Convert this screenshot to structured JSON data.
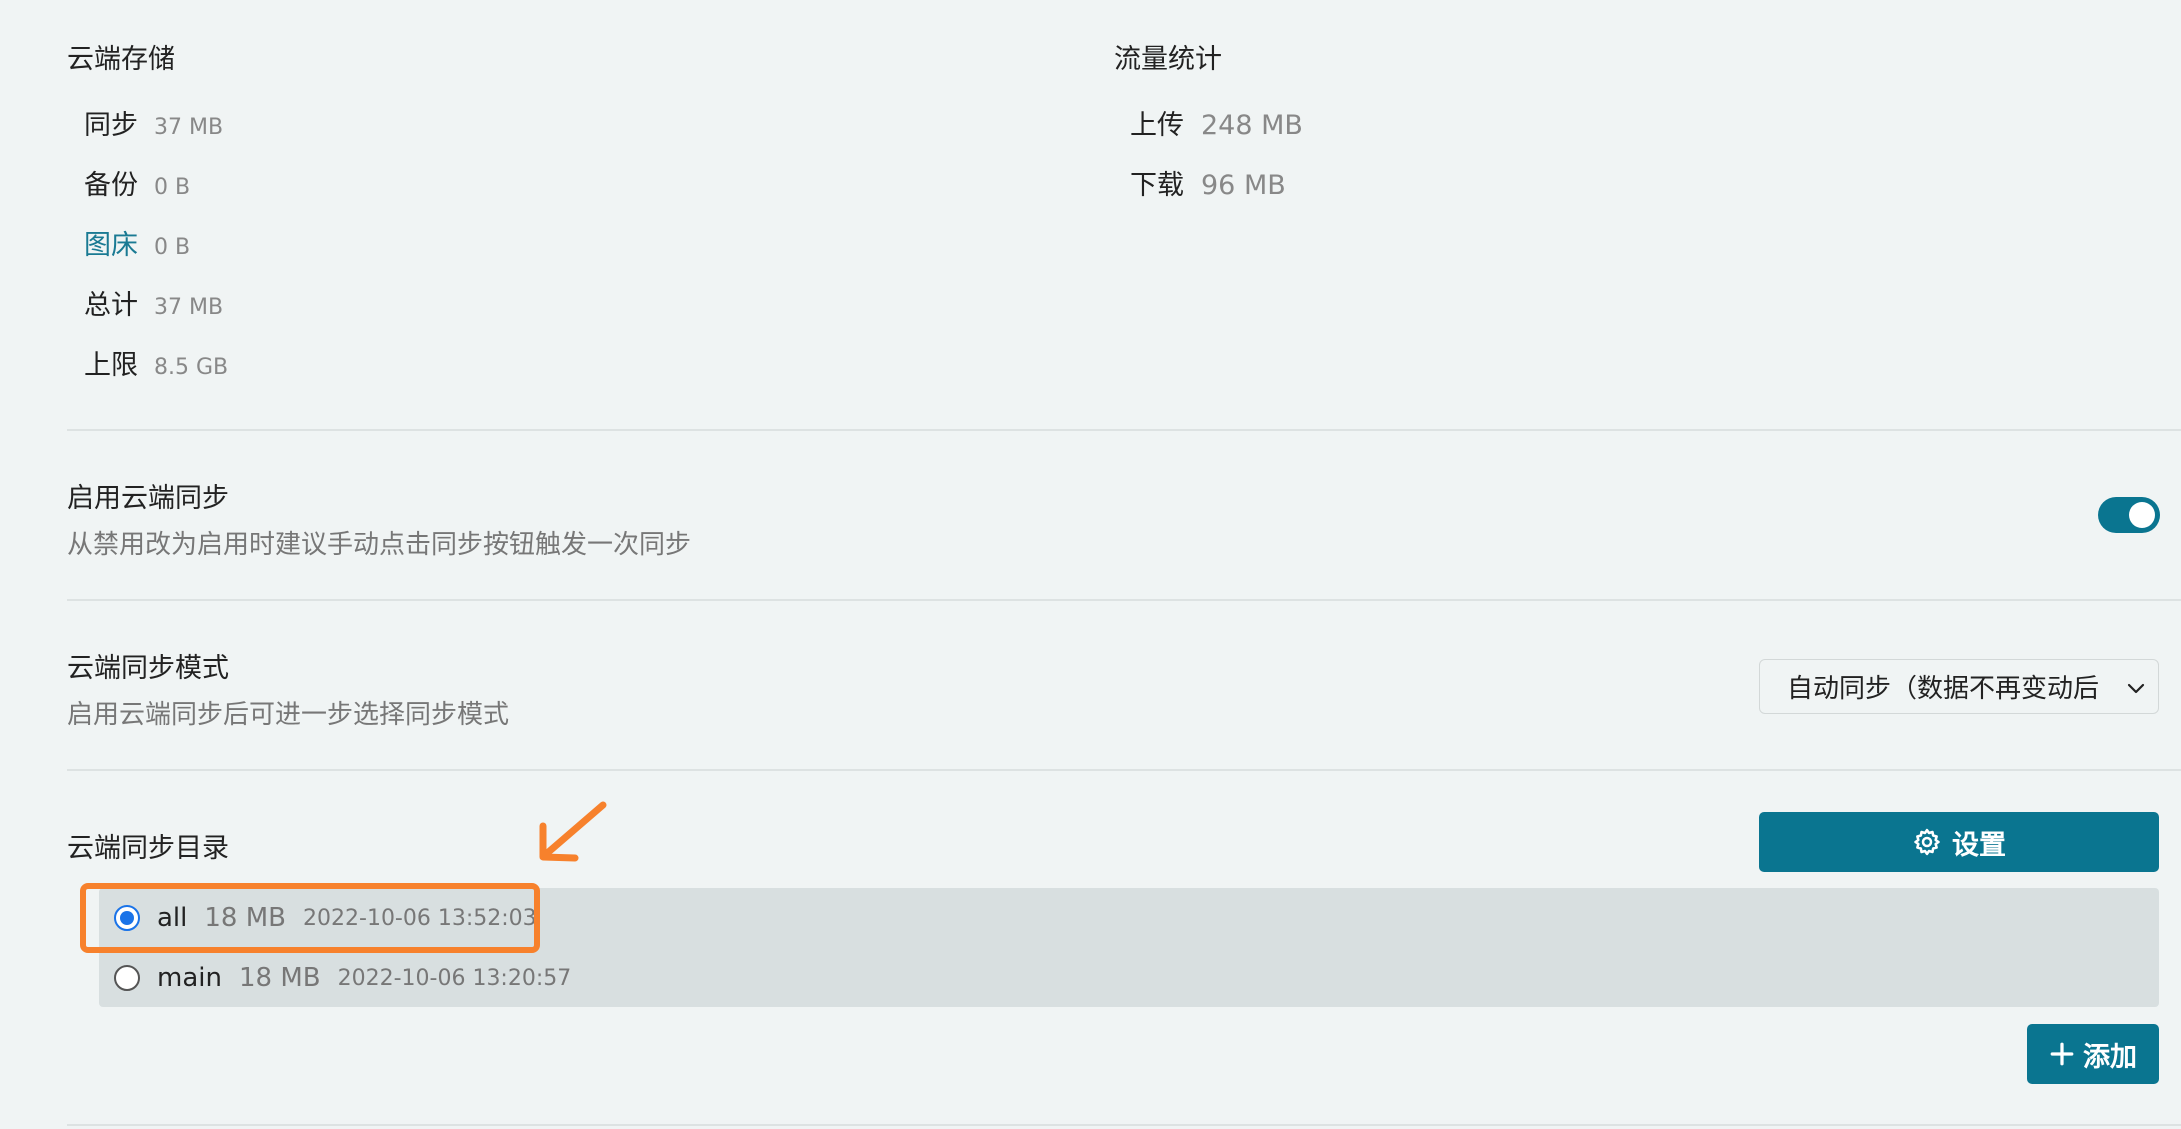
{
  "storage": {
    "title": "云端存储",
    "rows": [
      {
        "label": "同步",
        "value": "37 MB"
      },
      {
        "label": "备份",
        "value": "0 B"
      },
      {
        "label": "图床",
        "value": "0 B"
      },
      {
        "label": "总计",
        "value": "37 MB"
      },
      {
        "label": "上限",
        "value": "8.5 GB"
      }
    ]
  },
  "traffic": {
    "title": "流量统计",
    "rows": [
      {
        "label": "上传",
        "value": "248 MB"
      },
      {
        "label": "下载",
        "value": "96 MB"
      }
    ]
  },
  "enable_sync": {
    "title": "启用云端同步",
    "description": "从禁用改为启用时建议手动点击同步按钮触发一次同步",
    "enabled": true
  },
  "sync_mode": {
    "title": "云端同步模式",
    "description": "启用云端同步后可进一步选择同步模式",
    "selected": "自动同步（数据不再变动后"
  },
  "sync_dir": {
    "title": "云端同步目录",
    "settings_label": "设置",
    "add_label": "添加",
    "items": [
      {
        "name": "all",
        "size": "18 MB",
        "date": "2022-10-06 13:52:03",
        "selected": true
      },
      {
        "name": "main",
        "size": "18 MB",
        "date": "2022-10-06 13:20:57",
        "selected": false
      }
    ]
  },
  "colors": {
    "accent": "#0a7590",
    "annotation": "#f7812c",
    "link": "#1a7a93"
  }
}
